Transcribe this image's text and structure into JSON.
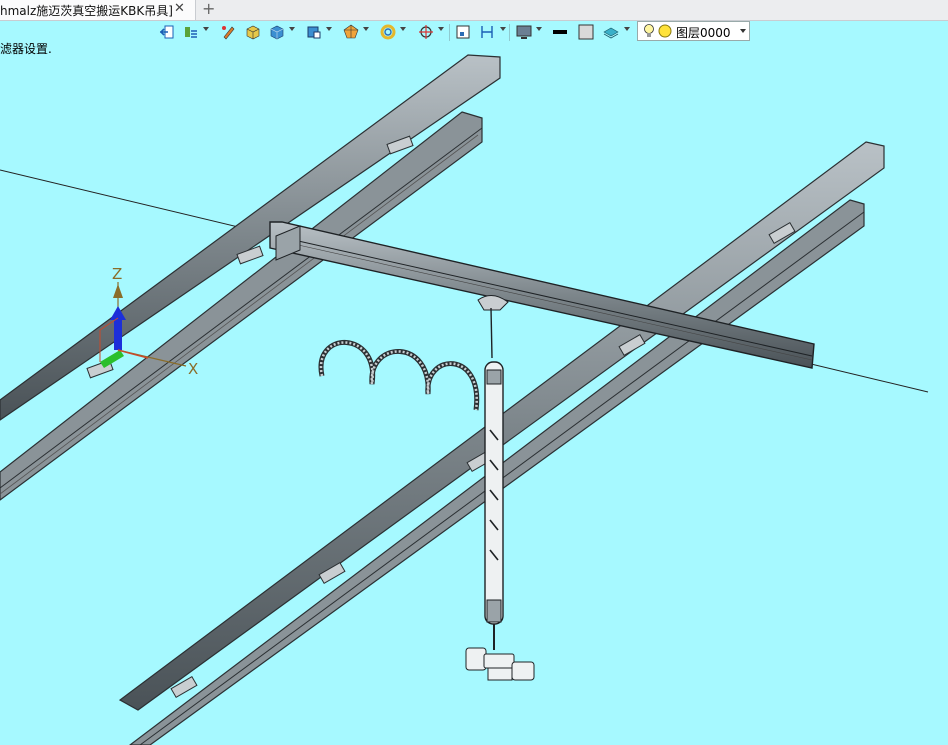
{
  "tab": {
    "title": "hmalz施迈茨真空搬运KBK吊具]",
    "close": "✕",
    "add": "+"
  },
  "toolbar": {
    "layer_name": "图层0000",
    "icons": [
      "exit-icon",
      "pick-filter-icon",
      "pencil-icon",
      "solid-box-icon",
      "shaded-cube-icon",
      "view-cube-icon",
      "render-mode-icon",
      "display-ring-icon",
      "crosshair-icon",
      "frame-icon",
      "dimension-icon",
      "monitor-icon",
      "line-color-swatch",
      "fill-color-swatch",
      "layer-stack-icon",
      "bulb-icon",
      "layer-status-icon"
    ]
  },
  "status_text": "滤器设置.",
  "axes": {
    "z": "Z",
    "x": "X"
  },
  "colors": {
    "background": "#a6f9ff",
    "steel": "#7d868b",
    "steel_dark": "#3a3f43",
    "axis_blue": "#1c2fd9",
    "axis_green": "#2bbf2b",
    "axis_red": "#c84a2a"
  }
}
